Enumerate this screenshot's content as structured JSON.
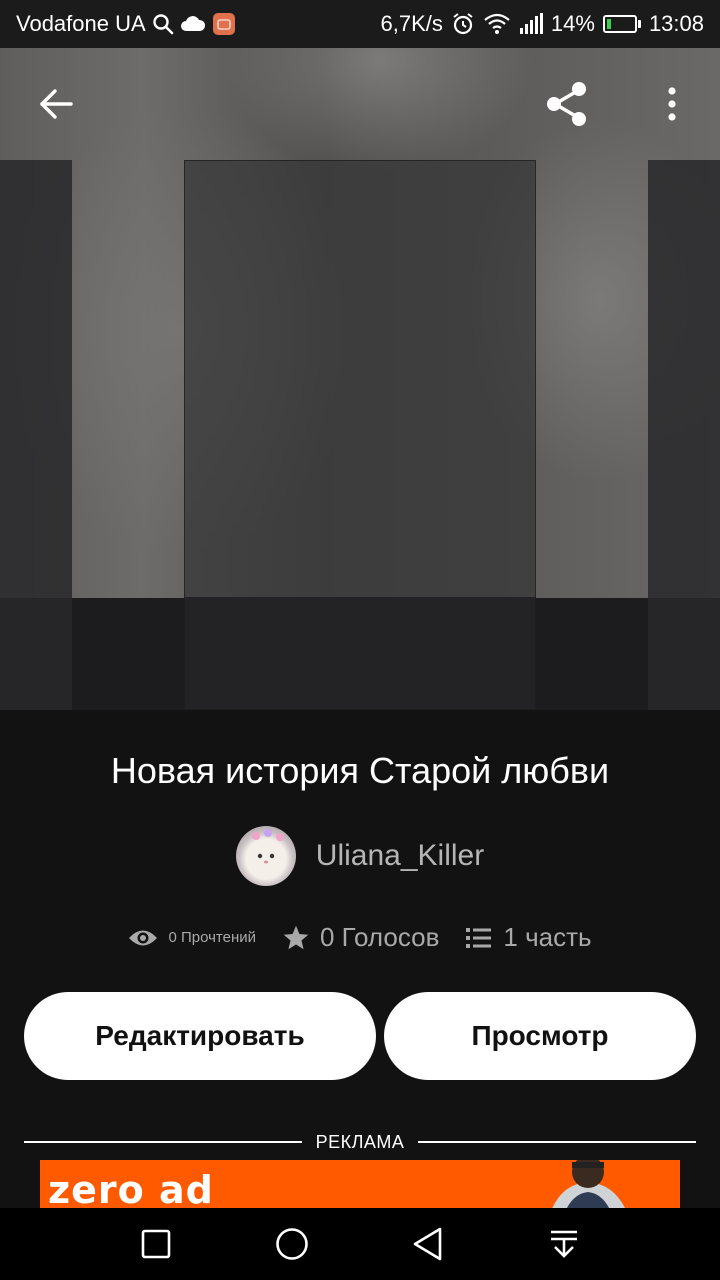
{
  "status_bar": {
    "carrier": "Vodafone UA",
    "speed": "6,7K/s",
    "battery": "14%",
    "battery_level": 0.14,
    "time": "13:08",
    "icons": [
      "search-icon",
      "cloud-icon",
      "app-notification-icon",
      "alarm-icon",
      "wifi-icon",
      "signal-icon",
      "battery-charging-icon"
    ]
  },
  "toolbar": {
    "back_icon": "arrow-left-icon",
    "share_icon": "share-icon",
    "more_icon": "more-vertical-icon"
  },
  "story": {
    "title": "Новая история Старой любви",
    "author": "Uliana_Killer",
    "reads": "0 Прочтений",
    "votes": "0 Голосов",
    "parts": "1 часть"
  },
  "actions": {
    "edit_label": "Редактировать",
    "view_label": "Просмотр"
  },
  "ad": {
    "label": "РЕКЛАМА",
    "banner_text": "zero ad",
    "banner_color": "#ff5a00"
  },
  "nav_bar": {
    "icons": [
      "recent-apps-icon",
      "home-icon",
      "back-triangle-icon",
      "notification-pulldown-icon"
    ]
  }
}
